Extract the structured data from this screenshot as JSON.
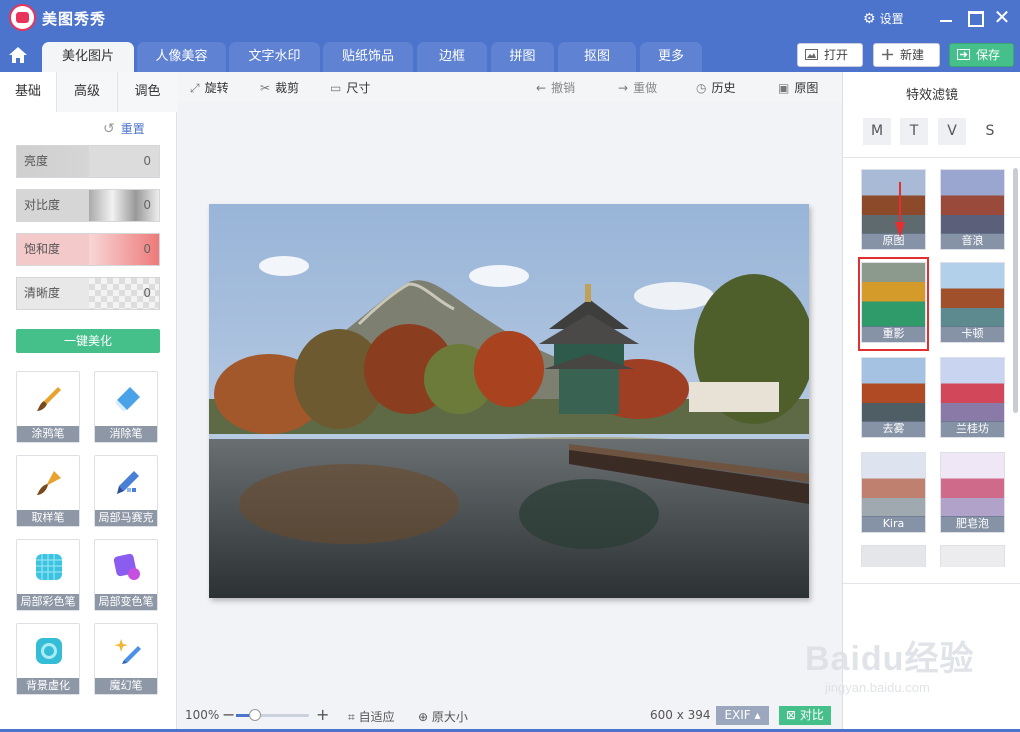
{
  "app": {
    "title": "美图秀秀",
    "settings": "设置"
  },
  "tabs": [
    "美化图片",
    "人像美容",
    "文字水印",
    "贴纸饰品",
    "边框",
    "拼图",
    "抠图",
    "更多"
  ],
  "top_buttons": {
    "open": "打开",
    "new": "新建",
    "save": "保存"
  },
  "left_panel": {
    "subtabs": [
      "基础",
      "高级",
      "调色"
    ],
    "reset": "重置",
    "sliders": [
      {
        "label": "亮度",
        "value": "0"
      },
      {
        "label": "对比度",
        "value": "0"
      },
      {
        "label": "饱和度",
        "value": "0"
      },
      {
        "label": "清晰度",
        "value": "0"
      }
    ],
    "one_key": "一键美化",
    "tools": [
      "涂鸦笔",
      "消除笔",
      "取样笔",
      "局部马赛克",
      "局部彩色笔",
      "局部变色笔",
      "背景虚化",
      "魔幻笔"
    ]
  },
  "toolbar": {
    "rotate": "旋转",
    "crop": "裁剪",
    "size": "尺寸",
    "undo": "撤销",
    "redo": "重做",
    "history": "历史",
    "original": "原图"
  },
  "status": {
    "zoom": "100%",
    "zoom_level": 0.26,
    "fit": "自适应",
    "actual": "原大小",
    "dimensions": "600 x 394",
    "exif": "EXIF",
    "compare": "对比"
  },
  "right_panel": {
    "title": "特效滤镜",
    "categories": [
      "M",
      "T",
      "V",
      "S"
    ],
    "filters": [
      "原图",
      "音浪",
      "重影",
      "卡顿",
      "去雾",
      "兰桂坊",
      "Kira",
      "肥皂泡"
    ]
  },
  "watermark": {
    "text": "Baidu经验",
    "sub": "jingyan.baidu.com"
  }
}
